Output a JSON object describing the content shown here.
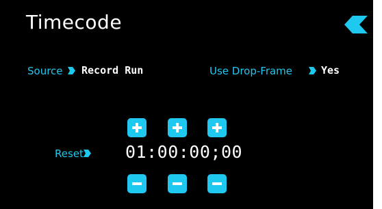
{
  "header": {
    "title": "Timecode",
    "back_icon": "back-chevron-icon"
  },
  "settings": {
    "source": {
      "label": "Source",
      "value": "Record Run"
    },
    "drop_frame": {
      "label": "Use Drop-Frame",
      "value": "Yes"
    }
  },
  "timecode": {
    "reset_label": "Reset",
    "value": "01:00:00;00"
  },
  "colors": {
    "accent": "#1ec8ee",
    "background": "#000000",
    "text": "#ffffff"
  }
}
